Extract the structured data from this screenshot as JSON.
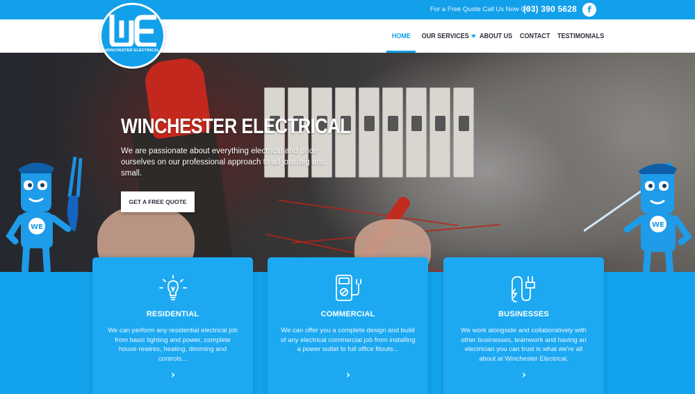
{
  "topbar": {
    "cta": "For a Free Quote Call Us Now On",
    "phone": "(03) 390 5628",
    "facebook_glyph": "f",
    "facebook_icon": "facebook-icon"
  },
  "logo": {
    "tagline": "WINCHESTER ELECTRICAL"
  },
  "nav": {
    "items": [
      {
        "label": "HOME",
        "active": true
      },
      {
        "label": "OUR SERVICES",
        "has_dropdown": true
      },
      {
        "label": "ABOUT US"
      },
      {
        "label": "CONTACT"
      },
      {
        "label": "TESTIMONIALS"
      }
    ]
  },
  "hero": {
    "title": "WINCHESTER ELECTRICAL",
    "text": "We are passionate about everything electrical and pride ourselves on our professional approach to all jobs big and small.",
    "button": "GET A FREE QUOTE"
  },
  "cards": [
    {
      "icon": "lightbulb-icon",
      "title": "RESIDENTIAL",
      "text": "We can perform any residential electrical job from basic lighting and power, complete house rewires, heating, dimming and controls...",
      "arrow": "›"
    },
    {
      "icon": "multimeter-icon",
      "title": "COMMERCIAL",
      "text": "We can offer you a complete design and build of any electrical commercial job from installing a power outlet to full office fitouts...",
      "arrow": "›"
    },
    {
      "icon": "plug-icon",
      "title": "BUSINESSES",
      "text": "We work alongside and collaboratively with other businesses, teamwork and having an electrician you can trust is what we're all about at Winchester Electrical.",
      "arrow": "›"
    }
  ],
  "colors": {
    "brand_blue": "#13a0ea",
    "card_blue": "#1da9f1",
    "nav_text": "#2c2f3a"
  }
}
